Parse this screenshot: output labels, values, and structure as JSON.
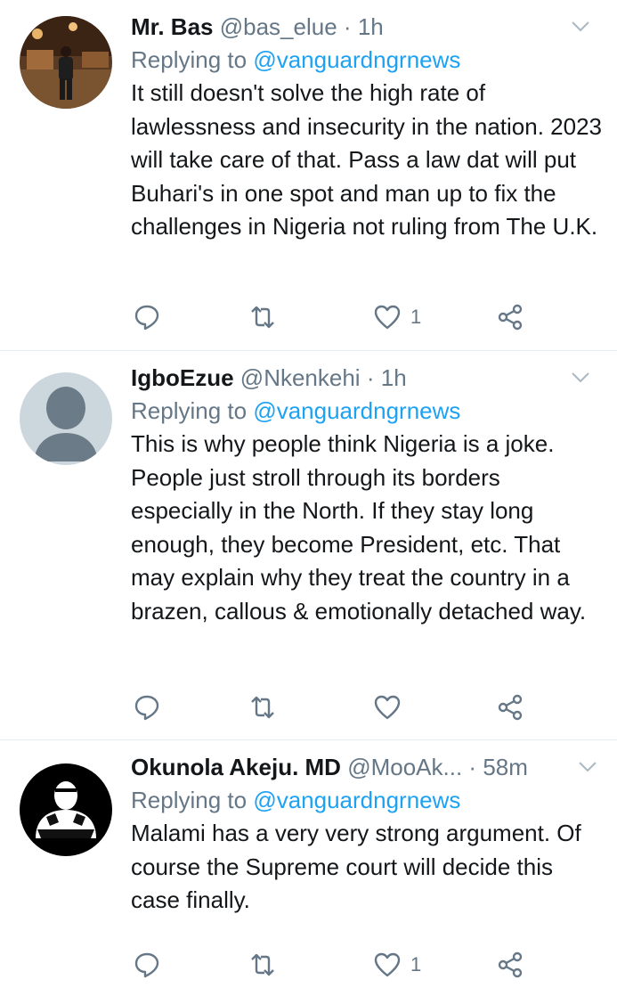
{
  "tweets": [
    {
      "name": "Mr. Bas",
      "handle": "@bas_elue",
      "sep": "·",
      "time": "1h",
      "replying_prefix": "Replying to",
      "replying_handle": "@vanguardngrnews",
      "text": "It still doesn't solve the high rate of lawlessness and insecurity in the nation. 2023 will take care of that. Pass a law dat will put Buhari's in one spot and man up to fix the challenges in Nigeria not ruling from The U.K.",
      "likes": "1"
    },
    {
      "name": "IgboEzue",
      "handle": "@Nkenkehi",
      "sep": "·",
      "time": "1h",
      "replying_prefix": "Replying to",
      "replying_handle": "@vanguardngrnews",
      "text": "This is why people think Nigeria is a joke. People just stroll through its borders especially in the North. If they stay long enough, they become President, etc. That may explain why they treat the country in a brazen, callous & emotionally detached way.",
      "likes": ""
    },
    {
      "name": "Okunola Akeju. MD",
      "handle": "@MooAk...",
      "sep": "·",
      "time": "58m",
      "replying_prefix": "Replying to",
      "replying_handle": "@vanguardngrnews",
      "text": "Malami has a very very strong argument. Of course the Supreme court will decide this case finally.",
      "likes": "1"
    }
  ],
  "icons": {
    "reply": "reply-icon",
    "retweet": "retweet-icon",
    "like": "heart-icon",
    "share": "share-icon",
    "caret": "chevron-down-icon"
  },
  "colors": {
    "link": "#1da1f2",
    "muted": "#657786",
    "text": "#14171a",
    "divider": "#e6ecf0"
  }
}
